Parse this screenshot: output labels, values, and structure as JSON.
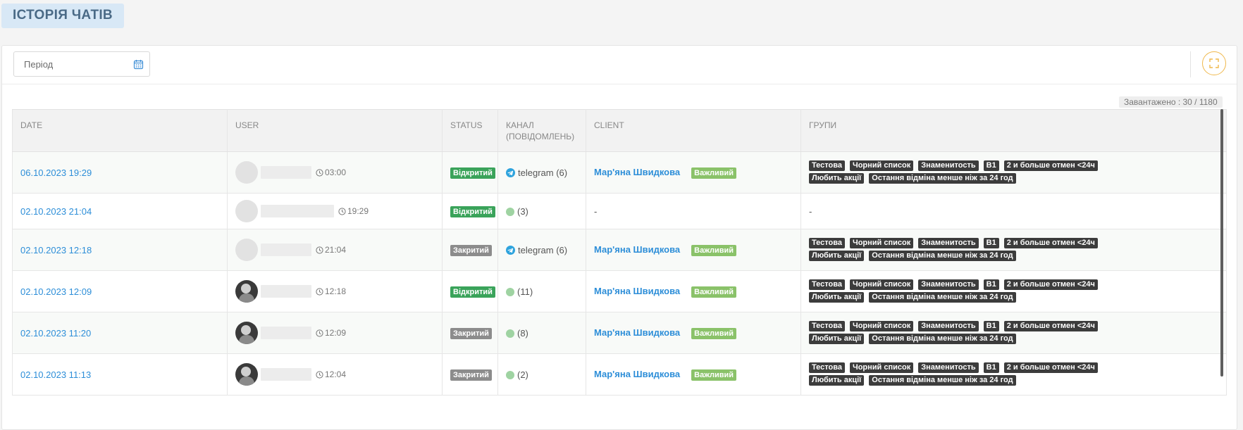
{
  "page": {
    "title": "ІСТОРІЯ ЧАТІВ"
  },
  "filters": {
    "period_placeholder": "Період"
  },
  "loaded_text": "Завантажено : 30 / 1180",
  "columns": [
    "DATE",
    "USER",
    "STATUS",
    "КАНАЛ (ПОВІДОМЛЕНЬ)",
    "CLIENT",
    "ГРУПИ"
  ],
  "rows": [
    {
      "date": "06.10.2023 19:29",
      "avatar": "placeholder",
      "time": "03:00",
      "status": "Відкритий",
      "status_type": "open",
      "channel_icon": "telegram-icon",
      "channel": "telegram (6)",
      "client": "Мар'яна Швидкова",
      "client_tag": "Важливий",
      "groups": [
        "Тестова",
        "Чорний список",
        "Знаменитость",
        "В1",
        "2 и больше отмен <24ч",
        "Любить акції",
        "Остання відміна менше ніж за 24 год"
      ]
    },
    {
      "date": "02.10.2023 21:04",
      "avatar": "placeholder",
      "time": "19:29",
      "status": "Відкритий",
      "status_type": "open",
      "channel_icon": "green-dot-icon",
      "channel": "(3)",
      "client": "-",
      "client_tag": "",
      "groups": [
        "-"
      ]
    },
    {
      "date": "02.10.2023 12:18",
      "avatar": "placeholder",
      "time": "21:04",
      "status": "Закритий",
      "status_type": "closed",
      "channel_icon": "telegram-icon",
      "channel": "telegram (6)",
      "client": "Мар'яна Швидкова",
      "client_tag": "Важливий",
      "groups": [
        "Тестова",
        "Чорний список",
        "Знаменитость",
        "В1",
        "2 и больше отмен <24ч",
        "Любить акції",
        "Остання відміна менше ніж за 24 год"
      ]
    },
    {
      "date": "02.10.2023 12:09",
      "avatar": "photo",
      "time": "12:18",
      "status": "Відкритий",
      "status_type": "open",
      "channel_icon": "green-dot-icon",
      "channel": "(11)",
      "client": "Мар'яна Швидкова",
      "client_tag": "Важливий",
      "groups": [
        "Тестова",
        "Чорний список",
        "Знаменитость",
        "В1",
        "2 и больше отмен <24ч",
        "Любить акції",
        "Остання відміна менше ніж за 24 год"
      ]
    },
    {
      "date": "02.10.2023 11:20",
      "avatar": "photo",
      "time": "12:09",
      "status": "Закритий",
      "status_type": "closed",
      "channel_icon": "green-dot-icon",
      "channel": "(8)",
      "client": "Мар'яна Швидкова",
      "client_tag": "Важливий",
      "groups": [
        "Тестова",
        "Чорний список",
        "Знаменитость",
        "В1",
        "2 и больше отмен <24ч",
        "Любить акції",
        "Остання відміна менше ніж за 24 год"
      ]
    },
    {
      "date": "02.10.2023 11:13",
      "avatar": "photo",
      "time": "12:04",
      "status": "Закритий",
      "status_type": "closed",
      "channel_icon": "green-dot-icon",
      "channel": "(2)",
      "client": "Мар'яна Швидкова",
      "client_tag": "Важливий",
      "groups": [
        "Тестова",
        "Чорний список",
        "Знаменитость",
        "В1",
        "2 и больше отмен <24ч",
        "Любить акції",
        "Остання відміна менше ніж за 24 год"
      ]
    }
  ],
  "colors": {
    "accent": "#2d8ed8",
    "open": "#3aa35a",
    "closed": "#8c8c8c",
    "vip": "#8ac269",
    "tag": "#3c3c3c",
    "fullscreen_border": "#f0b84c"
  }
}
